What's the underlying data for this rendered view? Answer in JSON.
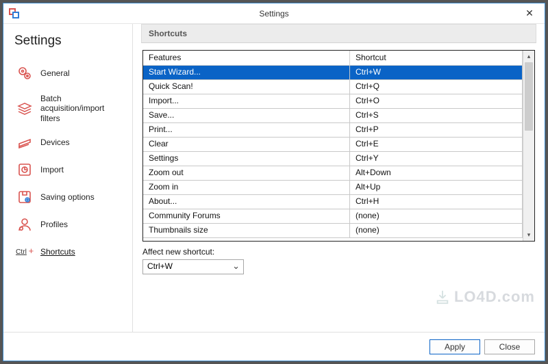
{
  "window": {
    "title": "Settings"
  },
  "sidebar": {
    "heading": "Settings",
    "items": [
      {
        "label": "General"
      },
      {
        "label": "Batch acquisition/import filters"
      },
      {
        "label": "Devices"
      },
      {
        "label": "Import"
      },
      {
        "label": "Saving options"
      },
      {
        "label": "Profiles"
      },
      {
        "label": "Shortcuts"
      }
    ]
  },
  "panel": {
    "heading": "Shortcuts",
    "columns": {
      "features": "Features",
      "shortcut": "Shortcut"
    },
    "rows": [
      {
        "feature": "Start Wizard...",
        "shortcut": "Ctrl+W",
        "selected": true
      },
      {
        "feature": "Quick Scan!",
        "shortcut": "Ctrl+Q"
      },
      {
        "feature": "Import...",
        "shortcut": "Ctrl+O"
      },
      {
        "feature": "Save...",
        "shortcut": "Ctrl+S"
      },
      {
        "feature": "Print...",
        "shortcut": "Ctrl+P"
      },
      {
        "feature": "Clear",
        "shortcut": "Ctrl+E"
      },
      {
        "feature": "Settings",
        "shortcut": "Ctrl+Y"
      },
      {
        "feature": "Zoom out",
        "shortcut": "Alt+Down"
      },
      {
        "feature": "Zoom in",
        "shortcut": "Alt+Up"
      },
      {
        "feature": "About...",
        "shortcut": "Ctrl+H"
      },
      {
        "feature": "Community Forums",
        "shortcut": "(none)"
      },
      {
        "feature": "Thumbnails size",
        "shortcut": "(none)"
      }
    ],
    "affect_label": "Affect new shortcut:",
    "affect_value": "Ctrl+W"
  },
  "footer": {
    "apply": "Apply",
    "close": "Close"
  },
  "watermark": "LO4D.com"
}
